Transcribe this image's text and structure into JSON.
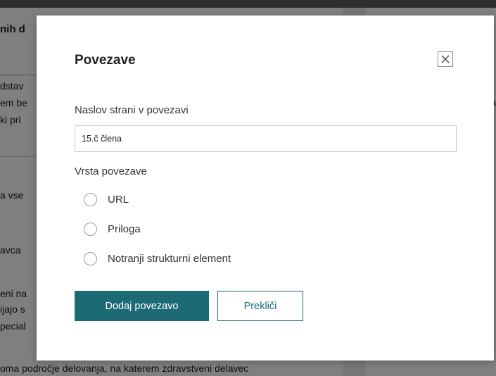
{
  "background": {
    "heading_fragment": "nih d",
    "text_fragments": [
      "dstav",
      "em be",
      "ki pri",
      "a vse",
      "avca",
      "eni na",
      "ijajo s",
      "pecial"
    ],
    "bottom_line": "oma področje delovanja, na katerem zdravstveni delavec",
    "right_fragment": "a"
  },
  "modal": {
    "title": "Povezave",
    "close_icon": "close-icon",
    "link_text_label": "Naslov strani v povezavi",
    "link_text_value": "15.č člena",
    "link_type_label": "Vrsta povezave",
    "link_type_options": [
      "URL",
      "Priloga",
      "Notranji strukturni element"
    ],
    "selected_option": null,
    "add_button_label": "Dodaj povezavo",
    "cancel_button_label": "Prekliči"
  },
  "colors": {
    "primary": "#1b6a74",
    "overlay": "rgba(0,0,0,0.5)"
  }
}
